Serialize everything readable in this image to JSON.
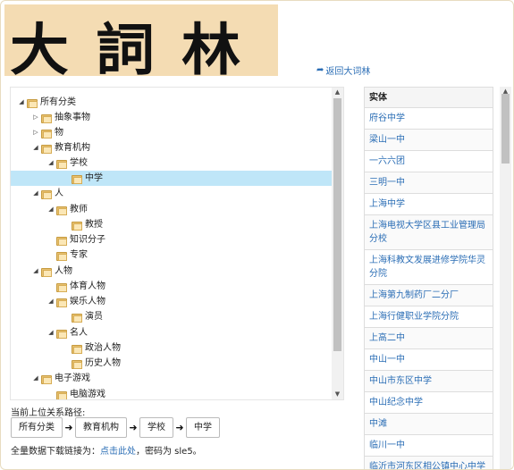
{
  "logo": {
    "text": "大詞林"
  },
  "back_link": {
    "label": "返回大词林"
  },
  "tree": {
    "nodes": [
      {
        "label": "所有分类",
        "caret": "◢"
      },
      {
        "label": "抽象事物",
        "caret": "▷"
      },
      {
        "label": "物",
        "caret": "▷"
      },
      {
        "label": "教育机构",
        "caret": "◢"
      },
      {
        "label": "学校",
        "caret": "◢"
      },
      {
        "label": "中学",
        "caret": "",
        "selected": true
      },
      {
        "label": "人",
        "caret": "◢"
      },
      {
        "label": "教师",
        "caret": "◢"
      },
      {
        "label": "教授",
        "caret": ""
      },
      {
        "label": "知识分子",
        "caret": ""
      },
      {
        "label": "专家",
        "caret": ""
      },
      {
        "label": "人物",
        "caret": "◢"
      },
      {
        "label": "体育人物",
        "caret": ""
      },
      {
        "label": "娱乐人物",
        "caret": "◢"
      },
      {
        "label": "演员",
        "caret": ""
      },
      {
        "label": "名人",
        "caret": "◢"
      },
      {
        "label": "政治人物",
        "caret": ""
      },
      {
        "label": "历史人物",
        "caret": ""
      },
      {
        "label": "电子游戏",
        "caret": "◢"
      },
      {
        "label": "电脑游戏",
        "caret": ""
      }
    ]
  },
  "path": {
    "label": "当前上位关系路径:",
    "crumbs": [
      "所有分类",
      "教育机构",
      "学校",
      "中学"
    ]
  },
  "download": {
    "prefix": "全量数据下载链接为：",
    "link": "点击此处",
    "suffix": "，密码为 sle5。"
  },
  "entities": {
    "header": "实体",
    "items": [
      "府谷中学",
      "梁山一中",
      "一六六团",
      "三明一中",
      "上海中学",
      "上海电视大学区县工业管理局分校",
      "上海科教文发展进修学院华灵分院",
      "上海第九制药厂二分厂",
      "上海行健职业学院分院",
      "上高二中",
      "中山一中",
      "中山市东区中学",
      "中山纪念中学",
      "中滩",
      "临川一中",
      "临沂市河东区相公镇中心中学"
    ]
  }
}
